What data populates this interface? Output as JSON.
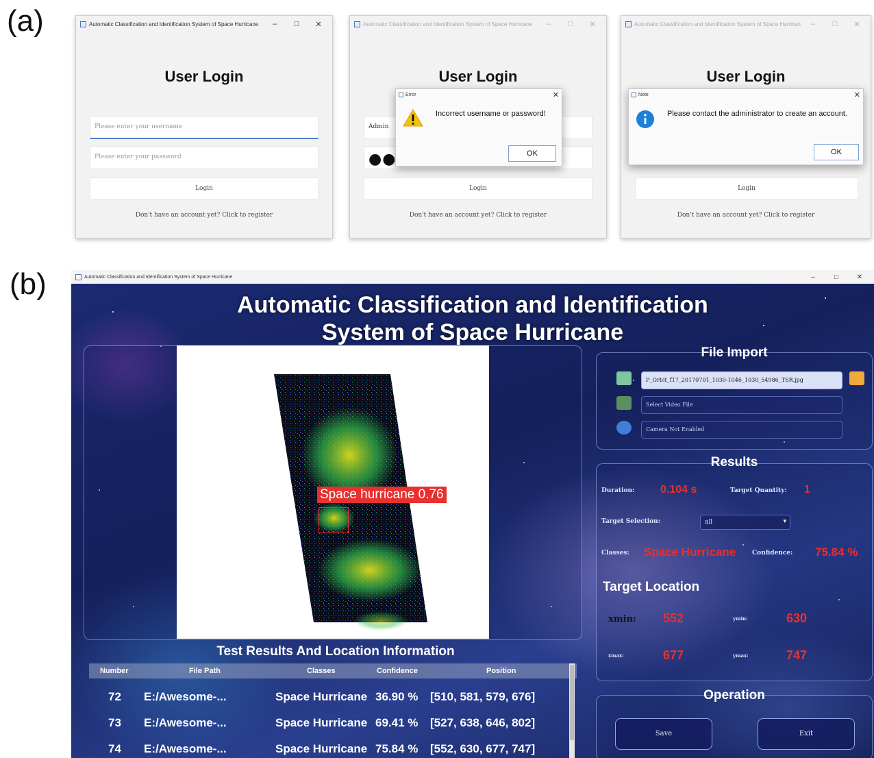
{
  "panel_labels": {
    "a": "(a)",
    "b": "(b)"
  },
  "login_windows": [
    {
      "window_title": "Automatic Classification and Identification System of Space Hurricane",
      "heading": "User Login",
      "username_placeholder": "Please enter your username",
      "password_placeholder": "Please enter your password",
      "login_label": "Login",
      "register_text": "Don't have an account yet? Click to register"
    },
    {
      "window_title": "Automatic Classification and Identification System of Space Hurricane",
      "heading": "User Login",
      "username_value": "Admin",
      "password_value": "●●●●●",
      "login_label": "Login",
      "register_text": "Don't have an account yet? Click to register",
      "dialog": {
        "title": "Error",
        "message": "Incorrect username or password!",
        "ok": "OK",
        "icon": "warning-icon"
      }
    },
    {
      "window_title": "Automatic Classification and Identification System of Space Hurricane",
      "heading": "User Login",
      "login_label": "Login",
      "register_text": "Don't have an account yet? Click to register",
      "dialog": {
        "title": "Note",
        "message": "Please contact the administrator to create an account.",
        "ok": "OK",
        "icon": "info-icon"
      }
    }
  ],
  "system": {
    "window_title": "Automatic Classification and Identification System of Space Hurricane",
    "title_line1": "Automatic Classification and Identification",
    "title_line2": "System of Space Hurricane",
    "detection_label": "Space hurricane 0.76",
    "file_import": {
      "heading": "File Import",
      "image_path": "P_Orbit_f17_20170701_1030-1046_1030_54986_TSR.jpg",
      "video_placeholder": "Select Video File",
      "camera_placeholder": "Camera Not Enabled"
    },
    "results": {
      "heading": "Results",
      "duration_label": "Duration:",
      "duration_value": "0.104 s",
      "quantity_label": "Target Quantity:",
      "quantity_value": "1",
      "selection_label": "Target Selection:",
      "selection_value": "all",
      "classes_label": "Classes:",
      "classes_value": "Space Hurricane",
      "confidence_label": "Confidence:",
      "confidence_value": "75.84 %"
    },
    "target_location": {
      "heading": "Target Location",
      "xmin_label": "xmin:",
      "xmin": "552",
      "ymin_label": "ymin:",
      "ymin": "630",
      "xmax_label": "xmax:",
      "xmax": "677",
      "ymax_label": "ymax:",
      "ymax": "747"
    },
    "table": {
      "heading": "Test Results And Location Information",
      "columns": [
        "Number",
        "File Path",
        "Classes",
        "Confidence",
        "Position"
      ],
      "rows": [
        {
          "number": "72",
          "path": "E:/Awesome-...",
          "classes": "Space Hurricane",
          "confidence": "36.90 %",
          "position": "[510, 581, 579, 676]"
        },
        {
          "number": "73",
          "path": "E:/Awesome-...",
          "classes": "Space Hurricane",
          "confidence": "69.41 %",
          "position": "[527, 638, 646, 802]"
        },
        {
          "number": "74",
          "path": "E:/Awesome-...",
          "classes": "Space Hurricane",
          "confidence": "75.84 %",
          "position": "[552, 630, 677, 747]"
        }
      ]
    },
    "operation": {
      "heading": "Operation",
      "save": "Save",
      "exit": "Exit"
    }
  },
  "colors": {
    "result_red": "#e8302f",
    "accent_blue": "#4d7fc9"
  }
}
